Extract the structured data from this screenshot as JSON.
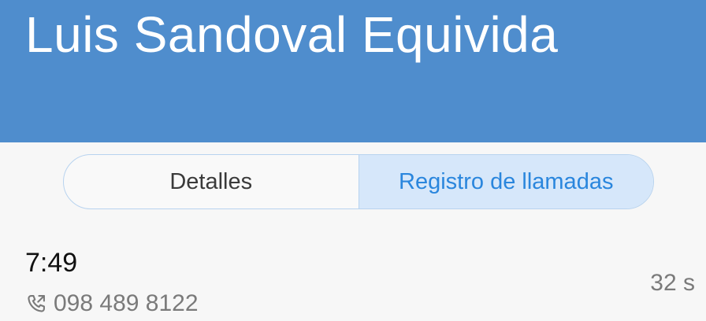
{
  "contact": {
    "name": "Luis Sandoval Equivida"
  },
  "tabs": [
    {
      "label": "Detalles",
      "selected": false
    },
    {
      "label": "Registro de llamadas",
      "selected": true
    }
  ],
  "call_log": [
    {
      "time": "7:49",
      "number": "098 489 8122",
      "duration": "32 s",
      "icon": "outgoing-call-icon"
    }
  ],
  "colors": {
    "header_bg": "#4f8dcd",
    "accent": "#2a86dd",
    "selected_tab_bg": "#d6e7fa"
  }
}
